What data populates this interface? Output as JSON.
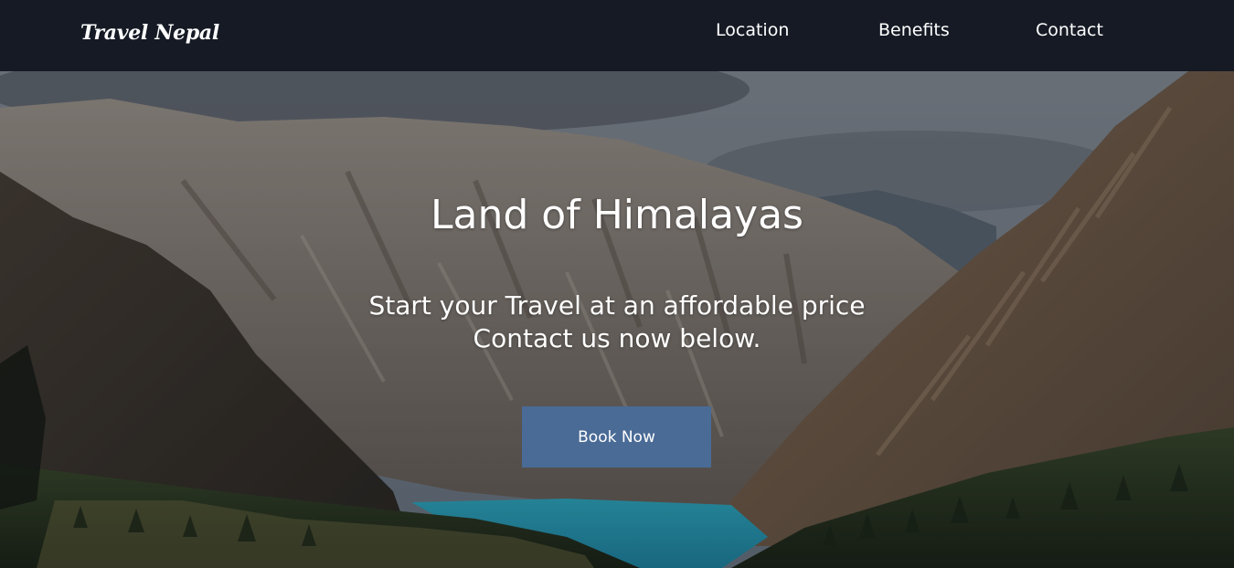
{
  "header": {
    "brand": "Travel Nepal",
    "nav": [
      {
        "label": "Location"
      },
      {
        "label": "Benefits"
      },
      {
        "label": "Contact"
      }
    ]
  },
  "hero": {
    "title": "Land of Himalayas",
    "subtitle_lines": [
      "Start your Travel at an affordable price",
      "Contact us now below."
    ],
    "cta_label": "Book Now"
  },
  "colors": {
    "navbar_bg": "#151a24",
    "cta_bg": "#4a6b96",
    "text": "#ffffff",
    "lake": "#35a9c4"
  }
}
